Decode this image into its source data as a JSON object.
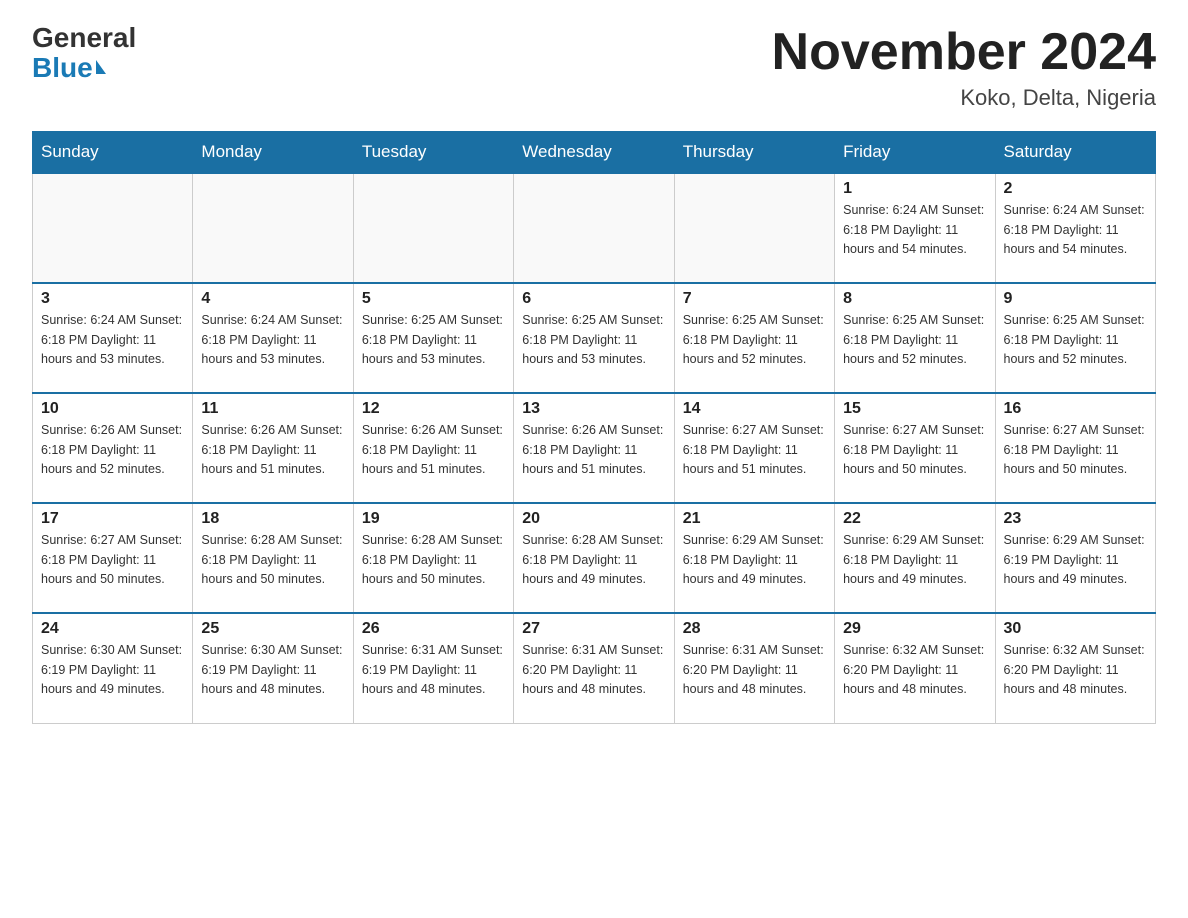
{
  "header": {
    "title": "November 2024",
    "location": "Koko, Delta, Nigeria",
    "logo_general": "General",
    "logo_blue": "Blue"
  },
  "weekdays": [
    "Sunday",
    "Monday",
    "Tuesday",
    "Wednesday",
    "Thursday",
    "Friday",
    "Saturday"
  ],
  "weeks": [
    [
      {
        "day": "",
        "info": ""
      },
      {
        "day": "",
        "info": ""
      },
      {
        "day": "",
        "info": ""
      },
      {
        "day": "",
        "info": ""
      },
      {
        "day": "",
        "info": ""
      },
      {
        "day": "1",
        "info": "Sunrise: 6:24 AM\nSunset: 6:18 PM\nDaylight: 11 hours\nand 54 minutes."
      },
      {
        "day": "2",
        "info": "Sunrise: 6:24 AM\nSunset: 6:18 PM\nDaylight: 11 hours\nand 54 minutes."
      }
    ],
    [
      {
        "day": "3",
        "info": "Sunrise: 6:24 AM\nSunset: 6:18 PM\nDaylight: 11 hours\nand 53 minutes."
      },
      {
        "day": "4",
        "info": "Sunrise: 6:24 AM\nSunset: 6:18 PM\nDaylight: 11 hours\nand 53 minutes."
      },
      {
        "day": "5",
        "info": "Sunrise: 6:25 AM\nSunset: 6:18 PM\nDaylight: 11 hours\nand 53 minutes."
      },
      {
        "day": "6",
        "info": "Sunrise: 6:25 AM\nSunset: 6:18 PM\nDaylight: 11 hours\nand 53 minutes."
      },
      {
        "day": "7",
        "info": "Sunrise: 6:25 AM\nSunset: 6:18 PM\nDaylight: 11 hours\nand 52 minutes."
      },
      {
        "day": "8",
        "info": "Sunrise: 6:25 AM\nSunset: 6:18 PM\nDaylight: 11 hours\nand 52 minutes."
      },
      {
        "day": "9",
        "info": "Sunrise: 6:25 AM\nSunset: 6:18 PM\nDaylight: 11 hours\nand 52 minutes."
      }
    ],
    [
      {
        "day": "10",
        "info": "Sunrise: 6:26 AM\nSunset: 6:18 PM\nDaylight: 11 hours\nand 52 minutes."
      },
      {
        "day": "11",
        "info": "Sunrise: 6:26 AM\nSunset: 6:18 PM\nDaylight: 11 hours\nand 51 minutes."
      },
      {
        "day": "12",
        "info": "Sunrise: 6:26 AM\nSunset: 6:18 PM\nDaylight: 11 hours\nand 51 minutes."
      },
      {
        "day": "13",
        "info": "Sunrise: 6:26 AM\nSunset: 6:18 PM\nDaylight: 11 hours\nand 51 minutes."
      },
      {
        "day": "14",
        "info": "Sunrise: 6:27 AM\nSunset: 6:18 PM\nDaylight: 11 hours\nand 51 minutes."
      },
      {
        "day": "15",
        "info": "Sunrise: 6:27 AM\nSunset: 6:18 PM\nDaylight: 11 hours\nand 50 minutes."
      },
      {
        "day": "16",
        "info": "Sunrise: 6:27 AM\nSunset: 6:18 PM\nDaylight: 11 hours\nand 50 minutes."
      }
    ],
    [
      {
        "day": "17",
        "info": "Sunrise: 6:27 AM\nSunset: 6:18 PM\nDaylight: 11 hours\nand 50 minutes."
      },
      {
        "day": "18",
        "info": "Sunrise: 6:28 AM\nSunset: 6:18 PM\nDaylight: 11 hours\nand 50 minutes."
      },
      {
        "day": "19",
        "info": "Sunrise: 6:28 AM\nSunset: 6:18 PM\nDaylight: 11 hours\nand 50 minutes."
      },
      {
        "day": "20",
        "info": "Sunrise: 6:28 AM\nSunset: 6:18 PM\nDaylight: 11 hours\nand 49 minutes."
      },
      {
        "day": "21",
        "info": "Sunrise: 6:29 AM\nSunset: 6:18 PM\nDaylight: 11 hours\nand 49 minutes."
      },
      {
        "day": "22",
        "info": "Sunrise: 6:29 AM\nSunset: 6:18 PM\nDaylight: 11 hours\nand 49 minutes."
      },
      {
        "day": "23",
        "info": "Sunrise: 6:29 AM\nSunset: 6:19 PM\nDaylight: 11 hours\nand 49 minutes."
      }
    ],
    [
      {
        "day": "24",
        "info": "Sunrise: 6:30 AM\nSunset: 6:19 PM\nDaylight: 11 hours\nand 49 minutes."
      },
      {
        "day": "25",
        "info": "Sunrise: 6:30 AM\nSunset: 6:19 PM\nDaylight: 11 hours\nand 48 minutes."
      },
      {
        "day": "26",
        "info": "Sunrise: 6:31 AM\nSunset: 6:19 PM\nDaylight: 11 hours\nand 48 minutes."
      },
      {
        "day": "27",
        "info": "Sunrise: 6:31 AM\nSunset: 6:20 PM\nDaylight: 11 hours\nand 48 minutes."
      },
      {
        "day": "28",
        "info": "Sunrise: 6:31 AM\nSunset: 6:20 PM\nDaylight: 11 hours\nand 48 minutes."
      },
      {
        "day": "29",
        "info": "Sunrise: 6:32 AM\nSunset: 6:20 PM\nDaylight: 11 hours\nand 48 minutes."
      },
      {
        "day": "30",
        "info": "Sunrise: 6:32 AM\nSunset: 6:20 PM\nDaylight: 11 hours\nand 48 minutes."
      }
    ]
  ]
}
